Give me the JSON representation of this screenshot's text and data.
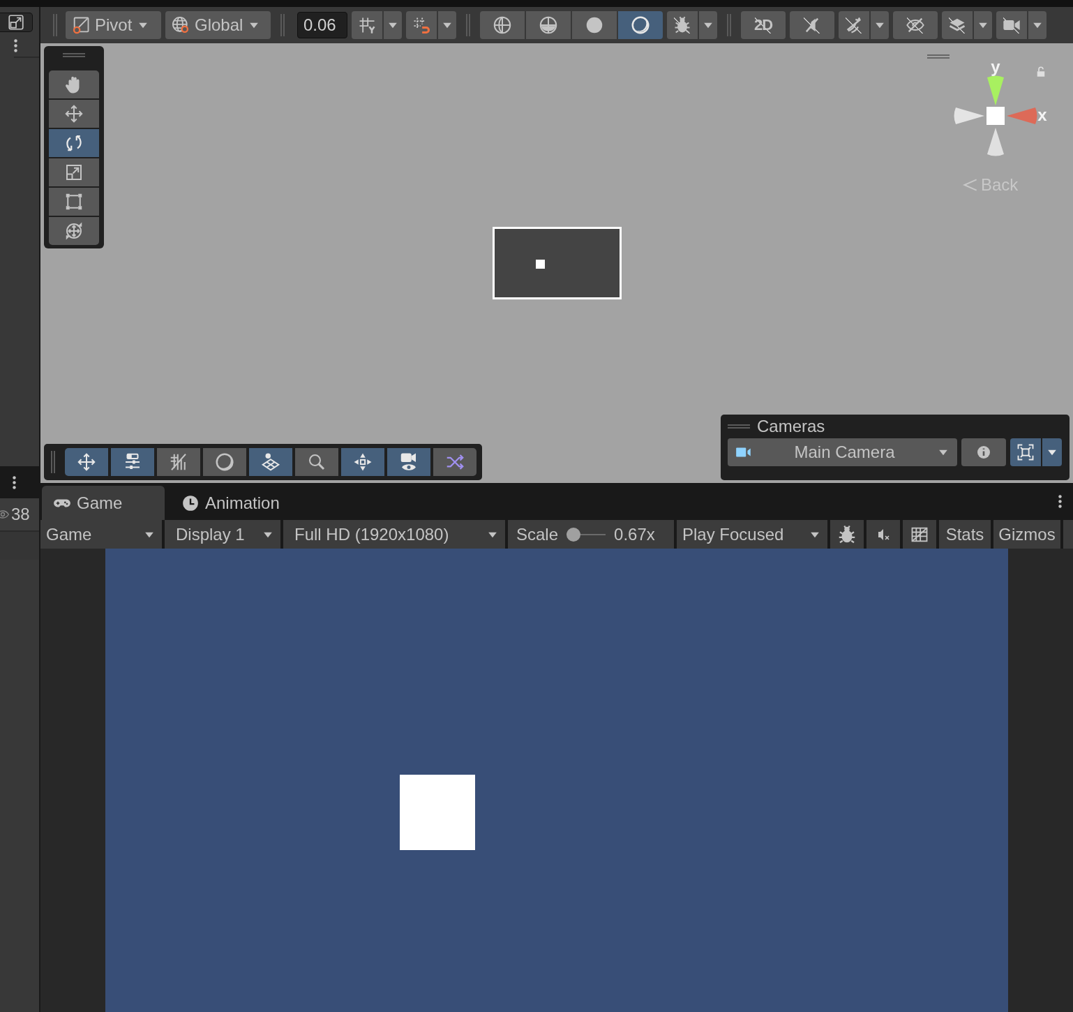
{
  "side_panel": {
    "visible_count": "38"
  },
  "scene_toolbar": {
    "pivot_mode": "Pivot",
    "handle_space": "Global",
    "snap_increment": "0.06",
    "snap_buttons": [
      {
        "kind": "grid-snap",
        "dropdown": true
      },
      {
        "kind": "increment-snap",
        "dropdown": true
      }
    ],
    "draw_modes": [
      {
        "kind": "wireframe",
        "selected": false
      },
      {
        "kind": "shaded-wireframe",
        "selected": false
      },
      {
        "kind": "shaded",
        "selected": false
      },
      {
        "kind": "unlit",
        "selected": true
      }
    ],
    "buttons": [
      {
        "kind": "debug",
        "dropdown": true,
        "separator_before": false
      },
      {
        "kind": "mode-2d",
        "label": "2D",
        "dropdown": false,
        "separator_before": true
      },
      {
        "kind": "audio",
        "dropdown": false,
        "separator_before": false
      },
      {
        "kind": "effects",
        "dropdown": true,
        "separator_before": false
      },
      {
        "kind": "visibility",
        "dropdown": false,
        "separator_before": false
      },
      {
        "kind": "layers",
        "dropdown": true,
        "separator_before": false
      },
      {
        "kind": "camera",
        "dropdown": true,
        "separator_before": false
      }
    ]
  },
  "scene_view": {
    "tools": [
      {
        "kind": "hand",
        "selected": false
      },
      {
        "kind": "move",
        "selected": false
      },
      {
        "kind": "rotate",
        "selected": true
      },
      {
        "kind": "scale",
        "selected": false
      },
      {
        "kind": "rect",
        "selected": false
      },
      {
        "kind": "transform",
        "selected": false
      }
    ],
    "gizmo": {
      "y_label": "y",
      "x_label": "x",
      "back": "Back"
    },
    "overlay_toolbar": [
      {
        "kind": "move",
        "selected": true
      },
      {
        "kind": "sliders",
        "selected": true
      },
      {
        "kind": "grid-hatch",
        "selected": false
      },
      {
        "kind": "lighting",
        "selected": false
      },
      {
        "kind": "plane",
        "selected": true
      },
      {
        "kind": "search",
        "selected": false
      },
      {
        "kind": "node",
        "selected": true
      },
      {
        "kind": "camera-eye",
        "selected": true
      },
      {
        "kind": "shuffle",
        "selected": false
      }
    ],
    "cameras": {
      "title": "Cameras",
      "camera": "Main Camera",
      "frame_selected": true
    }
  },
  "bottom_tabs": [
    {
      "kind": "game",
      "label": "Game",
      "selected": true
    },
    {
      "kind": "animation",
      "label": "Animation",
      "selected": false
    }
  ],
  "game_toolbar": {
    "view": "Game",
    "display": "Display 1",
    "resolution": "Full HD (1920x1080)",
    "scale_label": "Scale",
    "scale": {
      "level": 0
    },
    "scale_value": "0.67x",
    "play_mode": "Play Focused",
    "stats": "Stats",
    "gizmos": "Gizmos"
  }
}
